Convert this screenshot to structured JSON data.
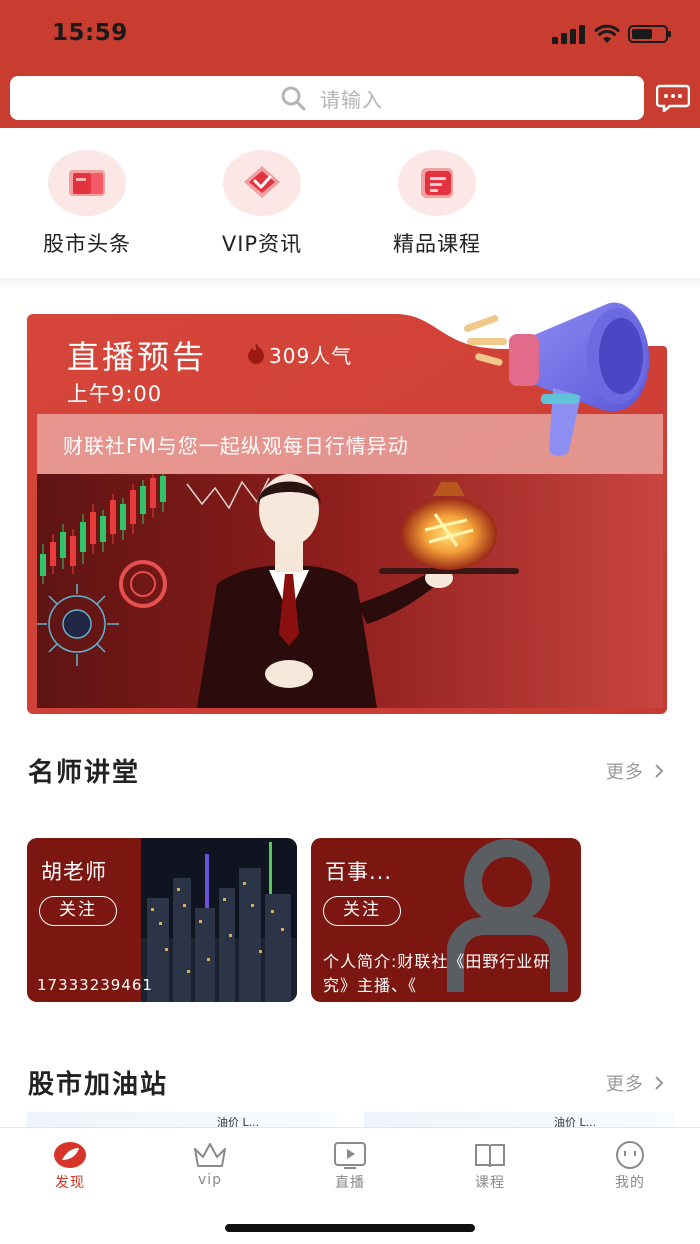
{
  "status_bar": {
    "time": "15:59"
  },
  "search": {
    "placeholder": "请输入"
  },
  "quick_nav": [
    {
      "label": "股市头条",
      "icon": "news-book-icon"
    },
    {
      "label": "VIP资讯",
      "icon": "vip-diamond-icon"
    },
    {
      "label": "精品课程",
      "icon": "course-doc-icon"
    }
  ],
  "live": {
    "title": "直播预告",
    "popularity": "309人气",
    "time": "上午9:00",
    "description": "财联社FM与您一起纵观每日行情异动"
  },
  "teachers_section": {
    "title": "名师讲堂",
    "more": "更多"
  },
  "teachers": [
    {
      "name": "胡老师",
      "follow": "关注",
      "phone": "17333239461"
    },
    {
      "name": "百事...",
      "follow": "关注",
      "intro": "个人简介:财联社《田野行业研究》主播、《"
    }
  ],
  "fuel_section": {
    "title": "股市加油站",
    "more": "更多"
  },
  "peek_cards": [
    {
      "label": "油价 L..."
    },
    {
      "label": "油价 L..."
    }
  ],
  "tabbar": [
    {
      "label": "发现",
      "active": true
    },
    {
      "label": "vip",
      "active": false
    },
    {
      "label": "直播",
      "active": false
    },
    {
      "label": "课程",
      "active": false
    },
    {
      "label": "我的",
      "active": false
    }
  ],
  "colors": {
    "brand_red": "#c93d30",
    "card_dark_red": "#7b1611",
    "active_tab": "#d8352a"
  }
}
